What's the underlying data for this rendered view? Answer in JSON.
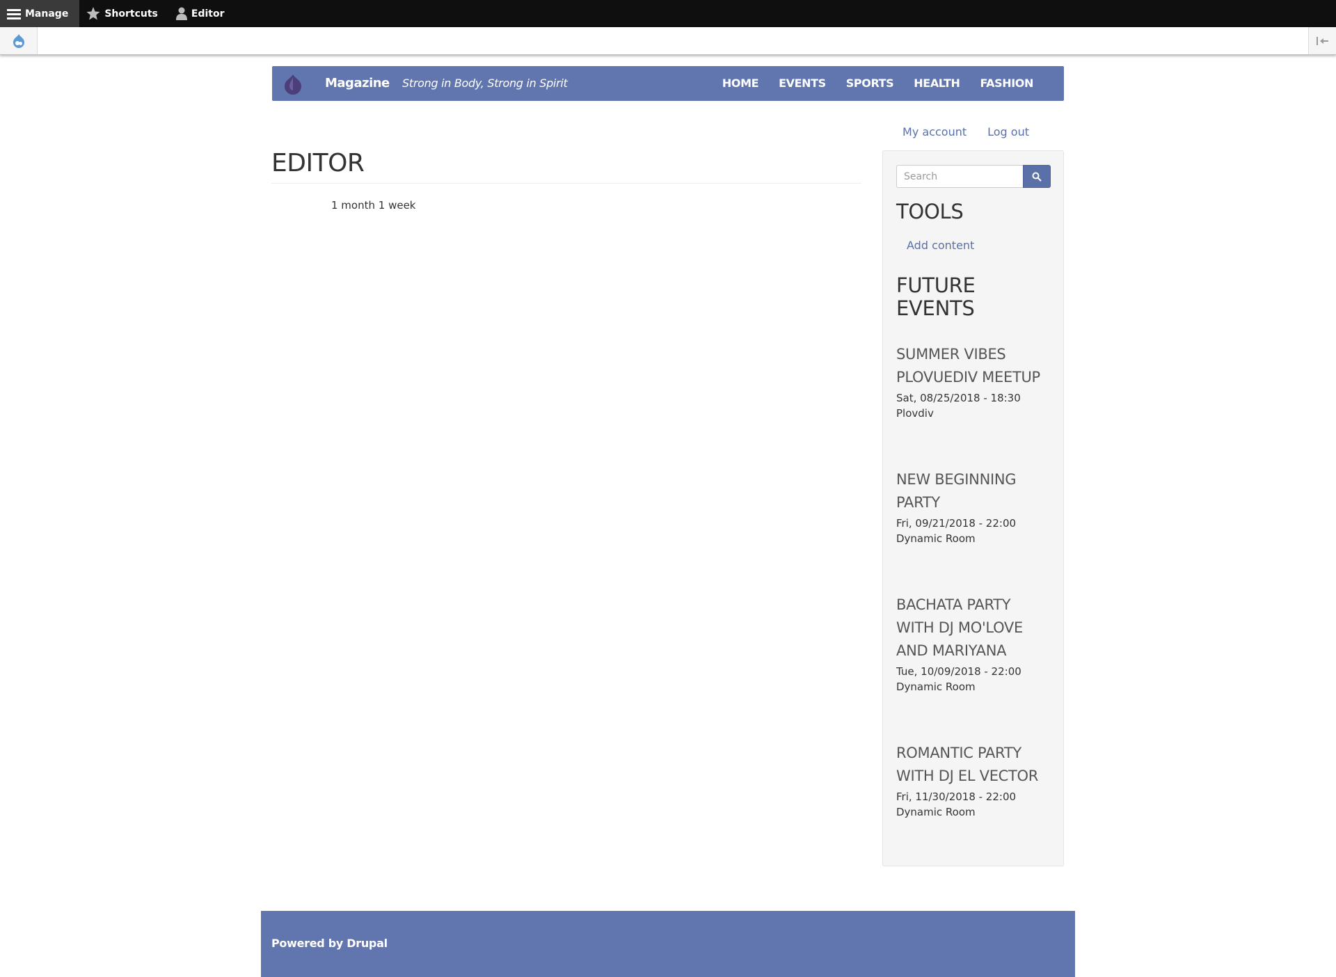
{
  "toolbar": {
    "manage_label": "Manage",
    "shortcuts_label": "Shortcuts",
    "user_label": "Editor"
  },
  "site": {
    "name": "Magazine",
    "slogan": "Strong in Body, Strong in Spirit",
    "nav": [
      "HOME",
      "EVENTS",
      "SPORTS",
      "HEALTH",
      "FASHION"
    ]
  },
  "secondary_menu": [
    "My account",
    "Log out"
  ],
  "main": {
    "title": "EDITOR",
    "member_for": "1 month 1 week"
  },
  "sidebar": {
    "search_placeholder": "Search",
    "tools_title": "TOOLS",
    "tools_link": "Add content",
    "events_title_line1": "FUTURE",
    "events_title_line2": "EVENTS",
    "events": [
      {
        "title_line1": "SUMMER VIBES",
        "title_line2": "PLOVUEDIV MEETUP",
        "title_line3": "",
        "date": "Sat, 08/25/2018 - 18:30",
        "location": "Plovdiv"
      },
      {
        "title_line1": "NEW BEGINNING",
        "title_line2": "PARTY",
        "title_line3": "",
        "date": "Fri, 09/21/2018 - 22:00",
        "location": "Dynamic Room"
      },
      {
        "title_line1": "BACHATA PARTY",
        "title_line2": "WITH DJ MO'LOVE",
        "title_line3": "AND MARIYANA",
        "date": "Tue, 10/09/2018 - 22:00",
        "location": "Dynamic Room"
      },
      {
        "title_line1": "ROMANTIC PARTY",
        "title_line2": "WITH DJ EL VECTOR",
        "title_line3": "",
        "date": "Fri, 11/30/2018 - 22:00",
        "location": "Dynamic Room"
      }
    ]
  },
  "footer": {
    "text": "Powered by Drupal"
  },
  "colors": {
    "brand": "#6175ae",
    "link": "#5a70a8",
    "toolbar_bg": "#0f0f0f"
  }
}
